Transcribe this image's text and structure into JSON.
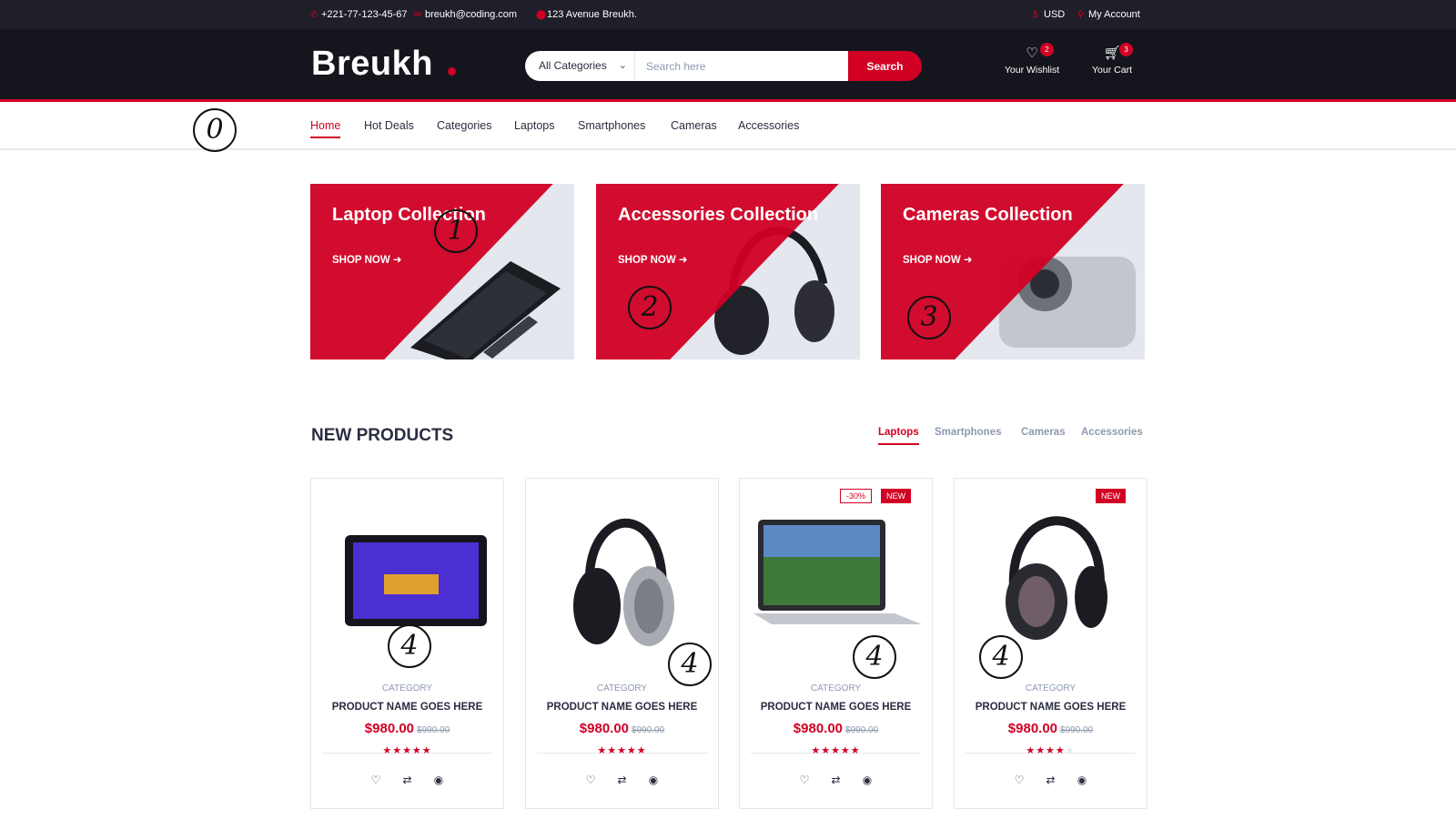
{
  "topbar": {
    "phone": "+221-77-123-45-67",
    "email": "breukh@coding.com",
    "address": "123 Avenue Breukh.",
    "currency": "USD",
    "account": "My Account"
  },
  "header": {
    "logo": "Breukh",
    "search": {
      "category": "All Categories",
      "placeholder": "Search here",
      "button": "Search"
    },
    "wishlist": {
      "label": "Your Wishlist",
      "count": "2"
    },
    "cart": {
      "label": "Your Cart",
      "count": "3"
    }
  },
  "nav": {
    "items": [
      "Home",
      "Hot Deals",
      "Categories",
      "Laptops",
      "Smartphones",
      "Cameras",
      "Accessories"
    ],
    "active": "Home"
  },
  "collections": [
    {
      "title": "Laptop Collection",
      "cta": "SHOP NOW"
    },
    {
      "title": "Accessories Collection",
      "cta": "SHOP NOW"
    },
    {
      "title": "Cameras Collection",
      "cta": "SHOP NOW"
    }
  ],
  "new_products": {
    "title": "NEW PRODUCTS",
    "tabs": [
      "Laptops",
      "Smartphones",
      "Cameras",
      "Accessories"
    ],
    "active_tab": "Laptops",
    "products": [
      {
        "category": "CATEGORY",
        "name": "PRODUCT NAME GOES HERE",
        "price": "$980.00",
        "old_price": "$990.00",
        "rating": 5,
        "badges": []
      },
      {
        "category": "CATEGORY",
        "name": "PRODUCT NAME GOES HERE",
        "price": "$980.00",
        "old_price": "$990.00",
        "rating": 5,
        "badges": []
      },
      {
        "category": "CATEGORY",
        "name": "PRODUCT NAME GOES HERE",
        "price": "$980.00",
        "old_price": "$990.00",
        "rating": 5,
        "badges": [
          "-30%",
          "NEW"
        ]
      },
      {
        "category": "CATEGORY",
        "name": "PRODUCT NAME GOES HERE",
        "price": "$980.00",
        "old_price": "$990.00",
        "rating": 4,
        "badges": [
          "NEW"
        ]
      }
    ]
  },
  "annotations": [
    "0",
    "1",
    "2",
    "3",
    "4",
    "4",
    "4",
    "4"
  ],
  "colors": {
    "accent": "#d10024",
    "dark": "#15161d",
    "topbar": "#1e1f29",
    "text": "#2b2d42",
    "muted": "#8d99ae"
  },
  "icons": {
    "phone": "phone-icon",
    "email": "envelope-icon",
    "address": "map-marker-icon",
    "currency": "dollar-icon",
    "account": "user-icon",
    "wishlist": "heart-icon",
    "cart": "shopping-cart-icon",
    "cta": "arrow-circle-right-icon",
    "product_actions": [
      "heart-icon",
      "exchange-icon",
      "eye-icon"
    ]
  }
}
